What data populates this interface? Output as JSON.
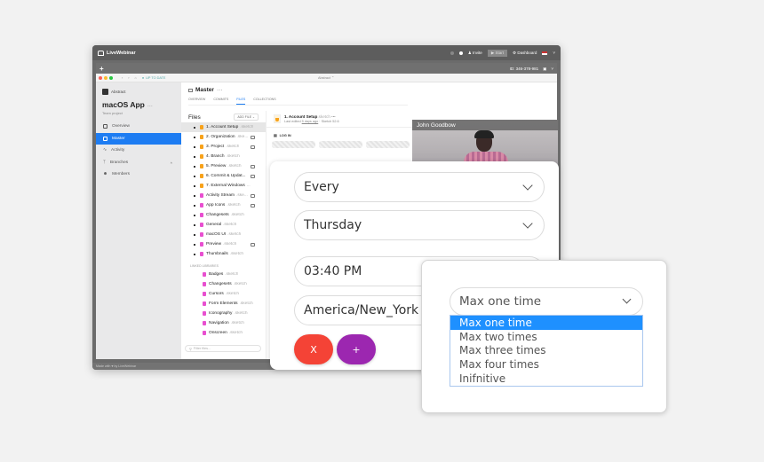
{
  "liveWebinar": {
    "brand": "LiveWebinar",
    "topbar": {
      "invite": "Invite",
      "start": "Start",
      "dashboard": "Dashboard"
    },
    "second_bar": {
      "add": "+",
      "id_label": "ID: 346-378-981"
    },
    "footer": "Made with ♥ by LiveWebinar"
  },
  "app": {
    "window": {
      "sync_status": "UP TO DATE",
      "title": "Abstract ⌃"
    },
    "sidebar": {
      "brand": "Abstract",
      "project": "macOS App",
      "project_more": "···",
      "project_type": "Team project",
      "items": [
        {
          "label": "Overview",
          "icon": "document-icon",
          "active": false
        },
        {
          "label": "Master",
          "icon": "branch-master-icon",
          "active": true
        },
        {
          "label": "Activity",
          "icon": "activity-icon",
          "active": false
        },
        {
          "label": "Branches",
          "icon": "branches-icon",
          "active": false
        },
        {
          "label": "Members",
          "icon": "members-icon",
          "active": false
        }
      ]
    },
    "main": {
      "branch": "Master",
      "branch_more": "···",
      "tabs": [
        "OVERVIEW",
        "COMMITS",
        "FILES",
        "COLLECTIONS"
      ],
      "active_tab": "FILES",
      "files_title": "Files",
      "add_file": "ADD FILE ⌄",
      "files": [
        {
          "name": "1. Account Setup",
          "ext": ".sketch",
          "color": "#f7a21b",
          "comments": false
        },
        {
          "name": "2. Organization",
          "ext": ".ske...",
          "color": "#f7a21b",
          "comments": true
        },
        {
          "name": "3. Project",
          "ext": ".sketch",
          "color": "#f7a21b",
          "comments": true
        },
        {
          "name": "4. Branch",
          "ext": ".sketch",
          "color": "#f7a21b",
          "comments": false
        },
        {
          "name": "5. Preview",
          "ext": ".sketch",
          "color": "#f7a21b",
          "comments": true
        },
        {
          "name": "6. Commit & Updat...",
          "ext": "",
          "color": "#f7a21b",
          "comments": true
        },
        {
          "name": "7. External Windows",
          "ext": "...",
          "color": "#f7a21b",
          "comments": false
        },
        {
          "name": "Activity Stream",
          "ext": ".ske...",
          "color": "#e84fd0",
          "comments": true
        },
        {
          "name": "App Icons",
          "ext": ".sketch",
          "color": "#e84fd0",
          "comments": true
        },
        {
          "name": "Changesets",
          "ext": ".sketch",
          "color": "#e84fd0",
          "comments": false
        },
        {
          "name": "General",
          "ext": ".sketch",
          "color": "#e84fd0",
          "comments": false
        },
        {
          "name": "macOS UI",
          "ext": ".sketch",
          "color": "#e84fd0",
          "comments": false
        },
        {
          "name": "Preview",
          "ext": ".sketch",
          "color": "#e84fd0",
          "comments": true
        },
        {
          "name": "Thumbnails",
          "ext": ".sketch",
          "color": "#e84fd0",
          "comments": false
        }
      ],
      "linked_header": "LINKED LIBRARIES",
      "linked": [
        {
          "name": "Badges",
          "ext": ".sketch"
        },
        {
          "name": "Changesets",
          "ext": ".sketch"
        },
        {
          "name": "Cursors",
          "ext": ".sketch"
        },
        {
          "name": "Form Elements",
          "ext": ".sketch"
        },
        {
          "name": "Iconography",
          "ext": ".sketch"
        },
        {
          "name": "Navigation",
          "ext": ".sketch"
        },
        {
          "name": "Onscreen",
          "ext": ".sketch"
        }
      ],
      "filter_placeholder": "Filter files..."
    },
    "detail": {
      "file_name": "1. Account Setup",
      "file_ext": ".sketch",
      "file_more": "···",
      "last_edited_prefix": "Last edited",
      "last_edited": "5 days ago",
      "sketch_version": "· Sketch 52.6",
      "page": "LOG IN"
    }
  },
  "video": {
    "participant": "John Goodbow"
  },
  "scheduler": {
    "recurrence": "Every",
    "day": "Thursday",
    "time": "03:40 PM",
    "timezone": "America/New_York",
    "cancel_label": "X",
    "add_label": "+",
    "cancel_color": "#f44336",
    "add_color": "#9c27b0"
  },
  "frequency": {
    "selected": "Max one time",
    "options": [
      "Max one time",
      "Max two times",
      "Max three times",
      "Max four times",
      "Inifnitive"
    ],
    "highlight_color": "#1e90ff"
  }
}
